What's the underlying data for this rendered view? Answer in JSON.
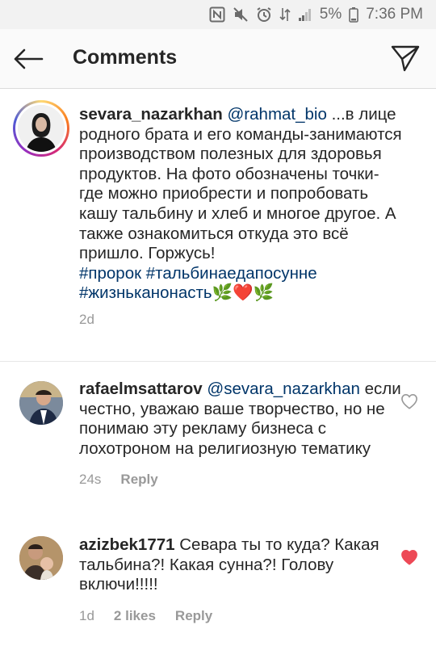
{
  "status_bar": {
    "battery_percent": "5%",
    "time": "7:36 PM"
  },
  "header": {
    "title": "Comments"
  },
  "caption": {
    "username": "sevara_nazarkhan",
    "mention": "@rahmat_bio",
    "text": " ...в лице родного брата и его команды-занимаются производством полезных для здоровья продуктов. На фото обозначены точки-где можно приобрести и попробовать кашу тальбину и хлеб и многое другое. А также ознакомиться откуда это всё пришло. Горжусь!",
    "hashtags_line1": "#пророк #тальбинаедапосунне",
    "hashtags_line2": "#жизньканонасть",
    "emoji": "🌿❤️🌿",
    "time": "2d"
  },
  "comments": [
    {
      "username": "rafaelmsattarov",
      "mention": "@sevara_nazarkhan",
      "text": "если честно, уважаю ваше творчество, но не понимаю эту рекламу бизнеса с лохотроном на религиозную тематику",
      "time": "24s",
      "likes": "",
      "reply": "Reply",
      "liked": false
    },
    {
      "username": "azizbek1771",
      "mention": "",
      "text": "Севара ты то куда? Какая тальбина?! Какая сунна?! Голову включи!!!!!",
      "time": "1d",
      "likes": "2 likes",
      "reply": "Reply",
      "liked": true
    }
  ],
  "colors": {
    "liked_heart": "#ed4956",
    "link": "#003569",
    "meta_text": "#999999"
  },
  "icons": {
    "back": "arrow-left-icon",
    "share": "paper-plane-icon",
    "like": "heart-icon"
  }
}
